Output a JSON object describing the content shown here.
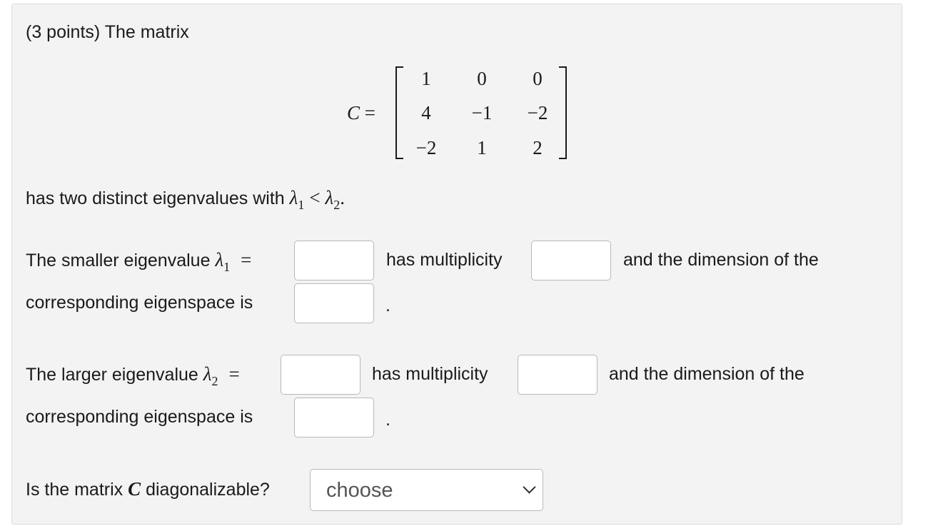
{
  "intro": "(3 points) The matrix",
  "matrix": {
    "name": "C",
    "equals": "=",
    "rows": [
      [
        "1",
        "0",
        "0"
      ],
      [
        "4",
        "−1",
        "−2"
      ],
      [
        "−2",
        "1",
        "2"
      ]
    ]
  },
  "statement": {
    "text": "has two distinct eigenvalues with",
    "lambda": "λ",
    "sub1": "1",
    "lt": "<",
    "sub2": "2",
    "period": "."
  },
  "q1": {
    "prefix": "The smaller eigenvalue",
    "lambda": "λ",
    "sub": "1",
    "equals": "=",
    "mult_label": "has multiplicity",
    "dim_label": "and the dimension of the",
    "eigenspace_label": "corresponding eigenspace is",
    "period": "."
  },
  "q2": {
    "prefix": "The larger eigenvalue",
    "lambda": "λ",
    "sub": "2",
    "equals": "=",
    "mult_label": "has multiplicity",
    "dim_label": "and the dimension of the",
    "eigenspace_label": "corresponding eigenspace is",
    "period": "."
  },
  "q3": {
    "prefix": "Is the matrix",
    "var": "C",
    "suffix": "diagonalizable?",
    "select_value": "choose"
  }
}
